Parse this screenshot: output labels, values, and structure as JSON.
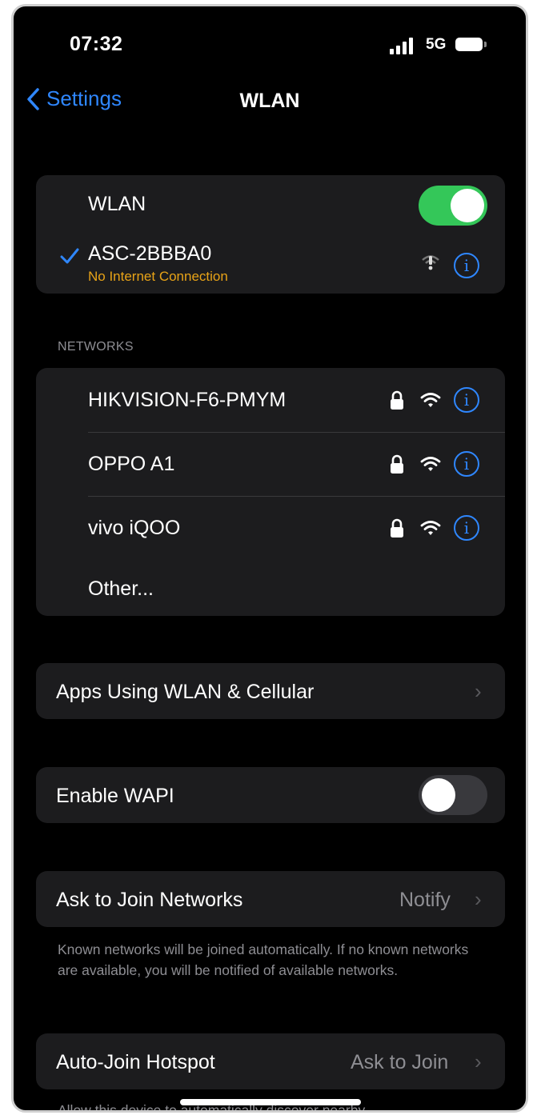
{
  "status_bar": {
    "time": "07:32",
    "network_type": "5G"
  },
  "nav": {
    "back_label": "Settings",
    "title": "WLAN"
  },
  "wlan_card": {
    "toggle_label": "WLAN",
    "toggle_on": true,
    "connected": {
      "name": "ASC-2BBBA0",
      "status": "No Internet Connection"
    }
  },
  "networks_header": "NETWORKS",
  "networks": [
    {
      "name": "HIKVISION-F6-PMYM"
    },
    {
      "name": "OPPO A1"
    },
    {
      "name": "vivo iQOO"
    }
  ],
  "other_label": "Other...",
  "apps_label": "Apps Using WLAN & Cellular",
  "wapi": {
    "label": "Enable WAPI",
    "on": false
  },
  "ask_join": {
    "label": "Ask to Join Networks",
    "value": "Notify",
    "footnote": "Known networks will be joined automatically. If no known networks are available, you will be notified of available networks."
  },
  "auto_hotspot": {
    "label": "Auto-Join Hotspot",
    "value": "Ask to Join",
    "footnote": "Allow this device to automatically discover nearby"
  },
  "colors": {
    "accent": "#2f87ff",
    "toggle_on": "#34c759",
    "warning": "#e8a317",
    "card": "#1c1c1e"
  }
}
